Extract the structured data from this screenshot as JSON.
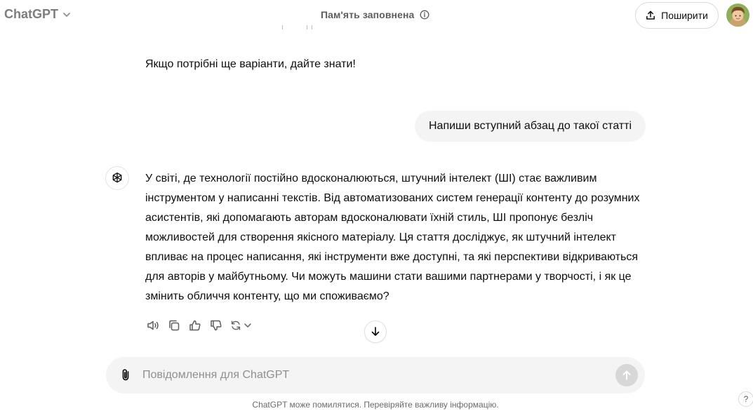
{
  "header": {
    "model_name": "ChatGPT",
    "memory_status": "Пам'ять заповнена",
    "share_label": "Поширити"
  },
  "conversation": {
    "previous_response_last_line": "Якщо потрібні ще варіанти, дайте знати!",
    "user_message": "Напиши вступний абзац до такої статті",
    "assistant_message": "У світі, де технології постійно вдосконалюються, штучний інтелект (ШІ) стає важливим інструментом у написанні текстів. Від автоматизованих систем генерації контенту до розумних асистентів, які допомагають авторам вдосконалювати їхній стиль, ШІ пропонує безліч можливостей для створення якісного матеріалу. Ця стаття досліджує, як штучний інтелект впливає на процес написання, які інструменти вже доступні, та які перспективи відкриваються для авторів у майбутньому. Чи можуть машини стати вашими партнерами у творчості, і як це змінить обличчя контенту, що ми споживаємо?"
  },
  "composer": {
    "placeholder": "Повідомлення для ChatGPT"
  },
  "footer": {
    "disclaimer": "ChatGPT може помилятися. Перевіряйте важливу інформацію.",
    "help_label": "?"
  },
  "icons": {
    "model_chevron": "chevron-down-icon",
    "memory_info": "info-icon",
    "share": "share-upload-icon",
    "assistant_avatar": "openai-logo-icon",
    "read_aloud": "speaker-icon",
    "copy": "copy-icon",
    "like": "thumbs-up-icon",
    "dislike": "thumbs-down-icon",
    "regenerate": "refresh-icon",
    "scroll_down": "arrow-down-icon",
    "attach": "paperclip-icon",
    "send": "arrow-up-icon"
  },
  "colors": {
    "bubble_bg": "#f4f4f4",
    "muted_text": "#7d7d7d",
    "send_disabled": "#d7d7d7"
  }
}
